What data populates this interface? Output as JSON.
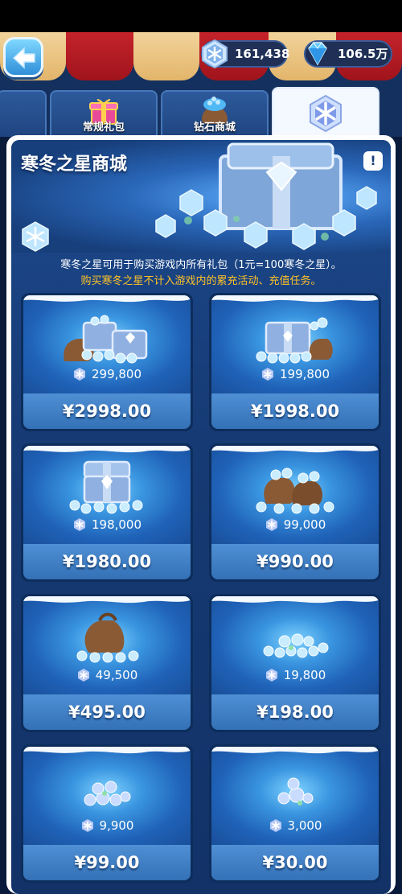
{
  "header": {
    "currencies": [
      {
        "icon": "snowflake-gem-icon",
        "value": "161,438"
      },
      {
        "icon": "diamond-icon",
        "value": "106.5万"
      }
    ]
  },
  "tabs": [
    {
      "label": "",
      "active": false
    },
    {
      "label": "常规礼包",
      "active": false
    },
    {
      "label": "钻石商城",
      "active": false
    },
    {
      "label": "",
      "active": true
    }
  ],
  "shop": {
    "title": "寒冬之星商城",
    "info_label": "!",
    "desc_line1": "寒冬之星可用于购买游戏内所有礼包（1元=100寒冬之星）。",
    "desc_line2": "购买寒冬之星不计入游戏内的累充活动、充值任务。",
    "packs": [
      {
        "amount": "299,800",
        "price": "¥2998.00",
        "art": "two-chests-bag"
      },
      {
        "amount": "199,800",
        "price": "¥1998.00",
        "art": "chest-bag"
      },
      {
        "amount": "198,000",
        "price": "¥1980.00",
        "art": "chest"
      },
      {
        "amount": "99,000",
        "price": "¥990.00",
        "art": "two-bags"
      },
      {
        "amount": "49,500",
        "price": "¥495.00",
        "art": "bag"
      },
      {
        "amount": "19,800",
        "price": "¥198.00",
        "art": "gem-pile"
      },
      {
        "amount": "9,900",
        "price": "¥99.00",
        "art": "small-pile"
      },
      {
        "amount": "3,000",
        "price": "¥30.00",
        "art": "few-gems"
      }
    ]
  },
  "colors": {
    "accent_gold": "#ffc226",
    "panel_blue": "#1d4a8e",
    "button_blue": "#3f80c6"
  }
}
